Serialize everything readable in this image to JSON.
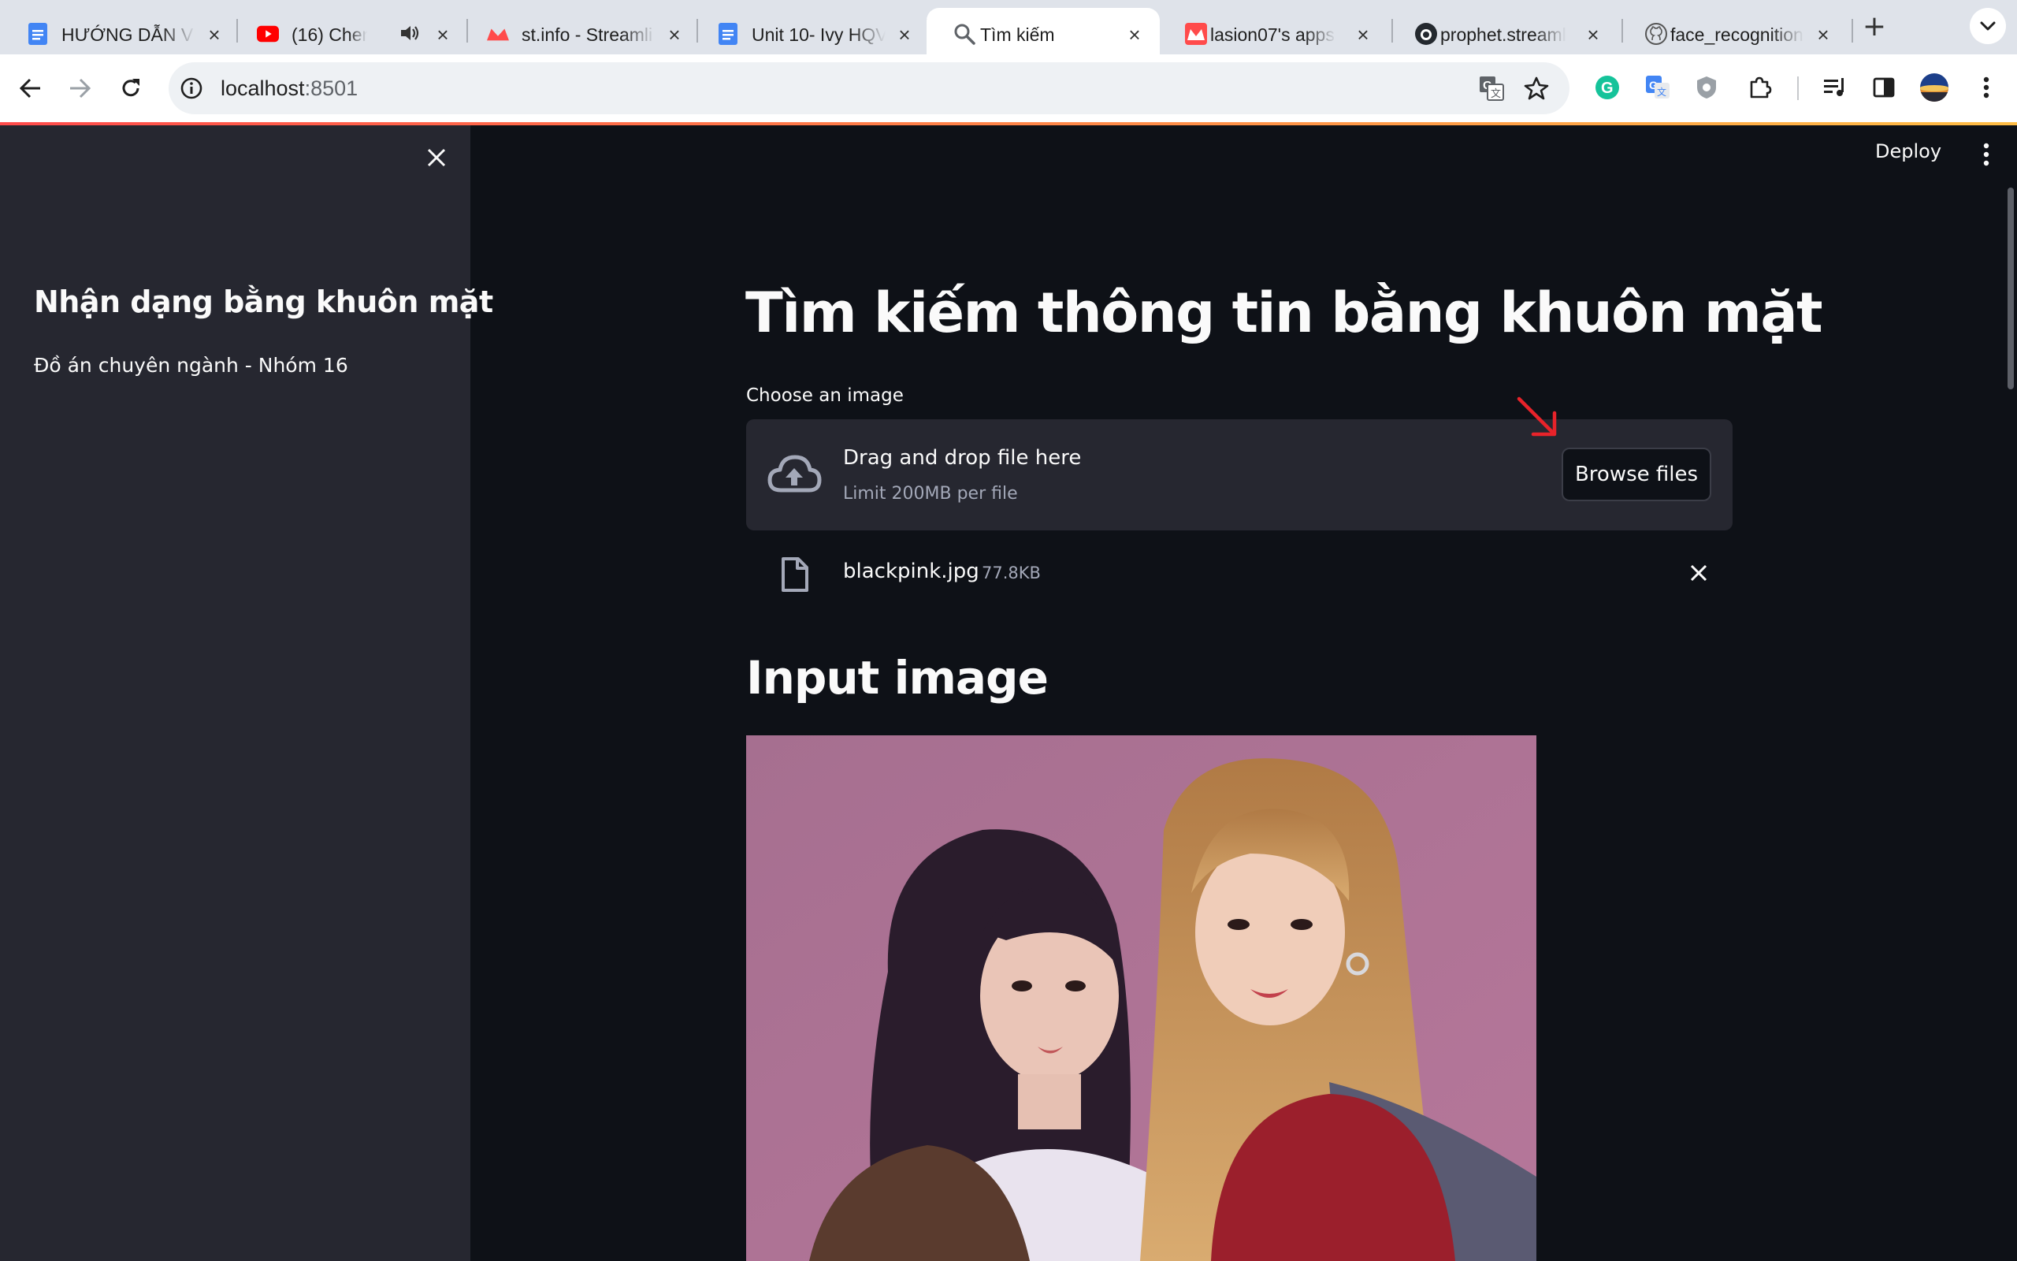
{
  "browser": {
    "tabs": [
      {
        "title": "HƯỚNG DẪN VIẾ",
        "icon": "google-docs-icon",
        "active": false
      },
      {
        "title": "(16) Cherry B",
        "icon": "youtube-icon",
        "active": false
      },
      {
        "title": "st.info - Streamli",
        "icon": "streamlit-icon",
        "active": false
      },
      {
        "title": "Unit 10- Ivy HQV",
        "icon": "google-docs-icon",
        "active": false
      },
      {
        "title": "Tìm kiếm",
        "icon": "search-icon",
        "active": true
      },
      {
        "title": "lasion07's apps",
        "icon": "streamlit-icon",
        "active": false
      },
      {
        "title": "prophet.streamli",
        "icon": "github-icon",
        "active": false
      },
      {
        "title": "face_recognition",
        "icon": "github-icon",
        "active": false
      }
    ],
    "url_host": "localhost",
    "url_port": ":8501"
  },
  "sidebar": {
    "title": "Nhận dạng bằng khuôn mặt",
    "subtitle": "Đồ án chuyên ngành - Nhóm 16"
  },
  "header": {
    "deploy_label": "Deploy"
  },
  "main": {
    "title": "Tìm kiếm thông tin bằng khuôn mặt",
    "uploader": {
      "label": "Choose an image",
      "drop_text": "Drag and drop file here",
      "limit_text": "Limit 200MB per file",
      "browse_label": "Browse files"
    },
    "uploaded_file": {
      "name": "blackpink.jpg",
      "size": "77.8KB"
    },
    "section_title": "Input image"
  },
  "colors": {
    "background": "#0e1117",
    "sidebar": "#262730",
    "text": "#fafafa",
    "accent_red": "#ff4b4b",
    "arrow": "#e8232a"
  }
}
